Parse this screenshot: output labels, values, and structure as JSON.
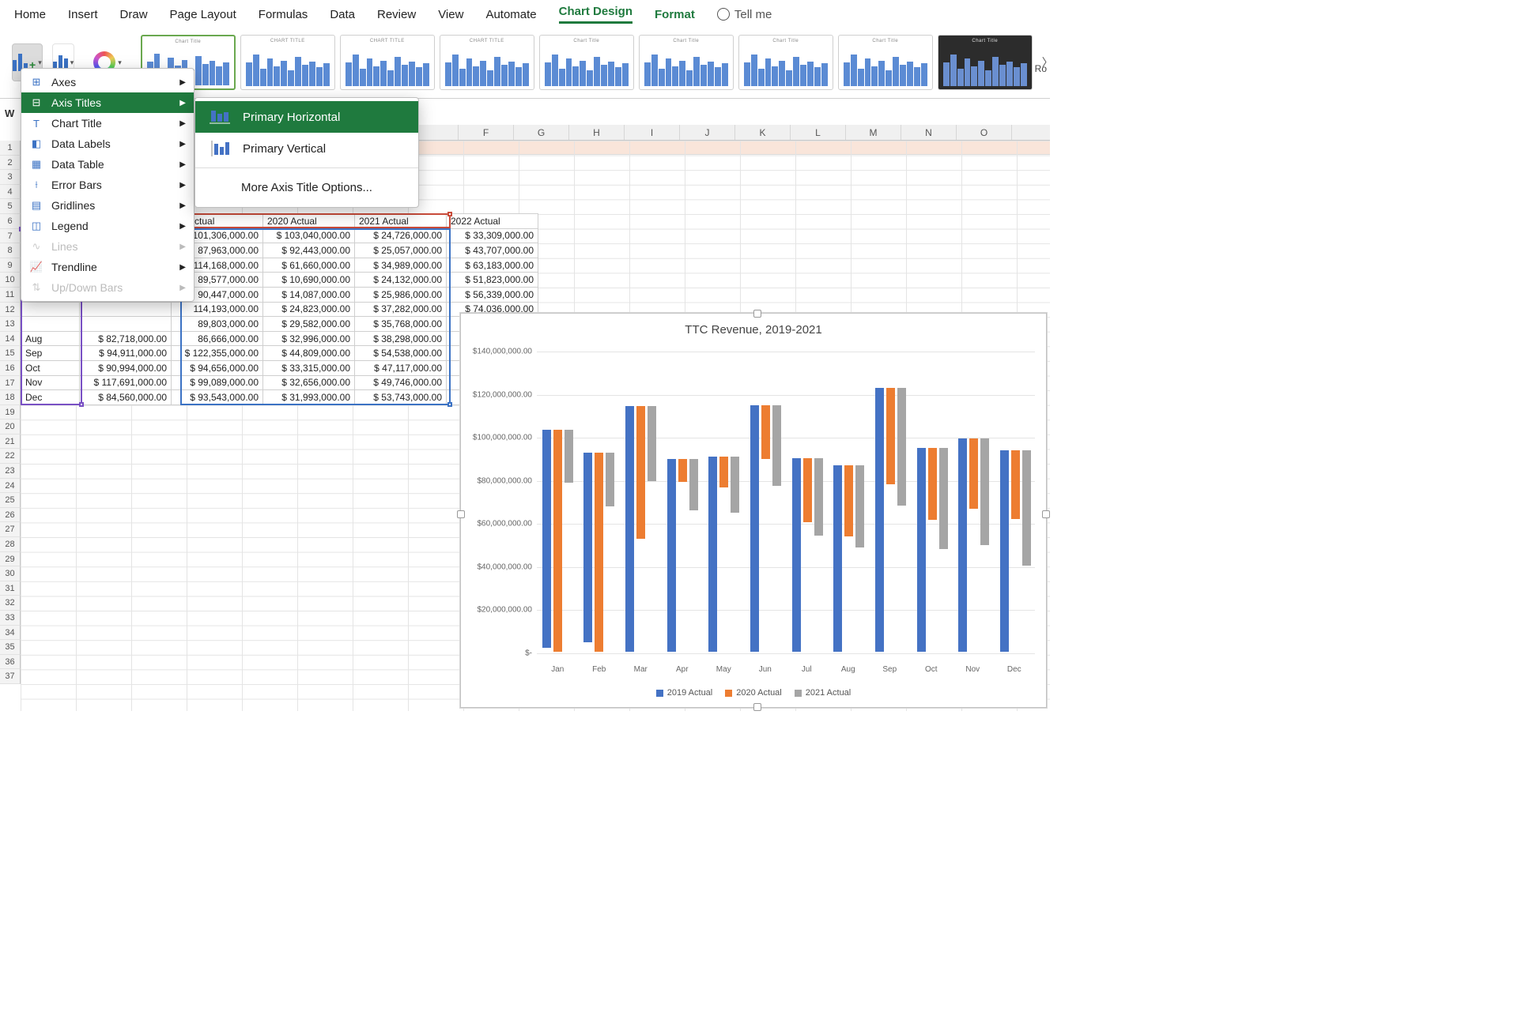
{
  "tabs": {
    "home": "Home",
    "insert": "Insert",
    "draw": "Draw",
    "page_layout": "Page Layout",
    "formulas": "Formulas",
    "data": "Data",
    "review": "Review",
    "view": "View",
    "automate": "Automate",
    "chart_design": "Chart Design",
    "format": "Format",
    "tell_me": "Tell me"
  },
  "ribbon_edge": "Ro",
  "gallery": {
    "thumbs": [
      "Chart Title",
      "CHART TITLE",
      "CHART TITLE",
      "CHART TITLE",
      "Chart Title",
      "Chart Title",
      "Chart Title",
      "Chart Title",
      "Chart Title"
    ]
  },
  "menu": {
    "items": [
      "Axes",
      "Axis Titles",
      "Chart Title",
      "Data Labels",
      "Data Table",
      "Error Bars",
      "Gridlines",
      "Legend",
      "Lines",
      "Trendline",
      "Up/Down Bars"
    ],
    "highlight": 1,
    "disabled": [
      8,
      10
    ]
  },
  "submenu": {
    "items": [
      "Primary Horizontal",
      "Primary Vertical"
    ],
    "highlight": 0,
    "more": "More Axis Title Options..."
  },
  "sheet": {
    "cols": [
      "F",
      "G",
      "H",
      "I",
      "J",
      "K",
      "L",
      "M",
      "N",
      "O"
    ],
    "rows": [
      "1",
      "2",
      "3",
      "4",
      "5",
      "6",
      "7",
      "8",
      "9",
      "10",
      "11",
      "12",
      "13",
      "14",
      "15",
      "16",
      "17",
      "18",
      "19",
      "20",
      "21",
      "22",
      "23",
      "24",
      "25",
      "26",
      "27",
      "28",
      "29",
      "30",
      "31",
      "32",
      "33",
      "34",
      "35",
      "36",
      "37"
    ],
    "w_label": "W",
    "headers": [
      "",
      "",
      "19 Actual",
      "2020 Actual",
      "2021 Actual",
      "2022 Actual"
    ],
    "data": [
      [
        "",
        "",
        "101,306,000.00",
        "$ 103,040,000.00",
        "$ 24,726,000.00",
        "$ 33,309,000.00"
      ],
      [
        "",
        "",
        "87,963,000.00",
        "$   92,443,000.00",
        "$ 25,057,000.00",
        "$ 43,707,000.00"
      ],
      [
        "",
        "",
        "114,168,000.00",
        "$   61,660,000.00",
        "$ 34,989,000.00",
        "$ 63,183,000.00"
      ],
      [
        "",
        "",
        "89,577,000.00",
        "$   10,690,000.00",
        "$ 24,132,000.00",
        "$ 51,823,000.00"
      ],
      [
        "",
        "",
        "90,447,000.00",
        "$   14,087,000.00",
        "$ 25,986,000.00",
        "$ 56,339,000.00"
      ],
      [
        "",
        "",
        "114,193,000.00",
        "$   24,823,000.00",
        "$ 37,282,000.00",
        "$ 74,036,000.00"
      ],
      [
        "",
        "",
        "89,803,000.00",
        "$   29,582,000.00",
        "$ 35,768,000.00",
        ""
      ],
      [
        "Aug",
        "$    82,718,000.00",
        "86,666,000.00",
        "$   32,996,000.00",
        "$ 38,298,000.00",
        ""
      ],
      [
        "Sep",
        "$    94,911,000.00",
        "$ 122,355,000.00",
        "$   44,809,000.00",
        "$ 54,538,000.00",
        ""
      ],
      [
        "Oct",
        "$    90,994,000.00",
        "$   94,656,000.00",
        "$   33,315,000.00",
        "$ 47,117,000.00",
        ""
      ],
      [
        "Nov",
        "$ 117,691,000.00",
        "$   99,089,000.00",
        "$   32,656,000.00",
        "$ 49,746,000.00",
        ""
      ],
      [
        "Dec",
        "$    84,560,000.00",
        "$   93,543,000.00",
        "$   31,993,000.00",
        "$ 53,743,000.00",
        ""
      ]
    ]
  },
  "chart_data": {
    "type": "bar",
    "title": "TTC Revenue, 2019-2021",
    "categories": [
      "Jan",
      "Feb",
      "Mar",
      "Apr",
      "May",
      "Jun",
      "Jul",
      "Aug",
      "Sep",
      "Oct",
      "Nov",
      "Dec"
    ],
    "series": [
      {
        "name": "2019 Actual",
        "color": "#4472c4",
        "values": [
          101306000,
          87963000,
          114168000,
          89577000,
          90447000,
          114193000,
          89803000,
          86666000,
          122355000,
          94656000,
          99089000,
          93543000
        ]
      },
      {
        "name": "2020 Actual",
        "color": "#ed7d31",
        "values": [
          103040000,
          92443000,
          61660000,
          10690000,
          14087000,
          24823000,
          29582000,
          32996000,
          44809000,
          33315000,
          32656000,
          31993000
        ]
      },
      {
        "name": "2021 Actual",
        "color": "#a5a5a5",
        "values": [
          24726000,
          25057000,
          34989000,
          24132000,
          25986000,
          37282000,
          35768000,
          38298000,
          54538000,
          47117000,
          49746000,
          53743000
        ]
      }
    ],
    "ylim": [
      0,
      140000000
    ],
    "yticks": [
      "$-",
      "$20,000,000.00",
      "$40,000,000.00",
      "$60,000,000.00",
      "$80,000,000.00",
      "$100,000,000.00",
      "$120,000,000.00",
      "$140,000,000.00"
    ]
  }
}
